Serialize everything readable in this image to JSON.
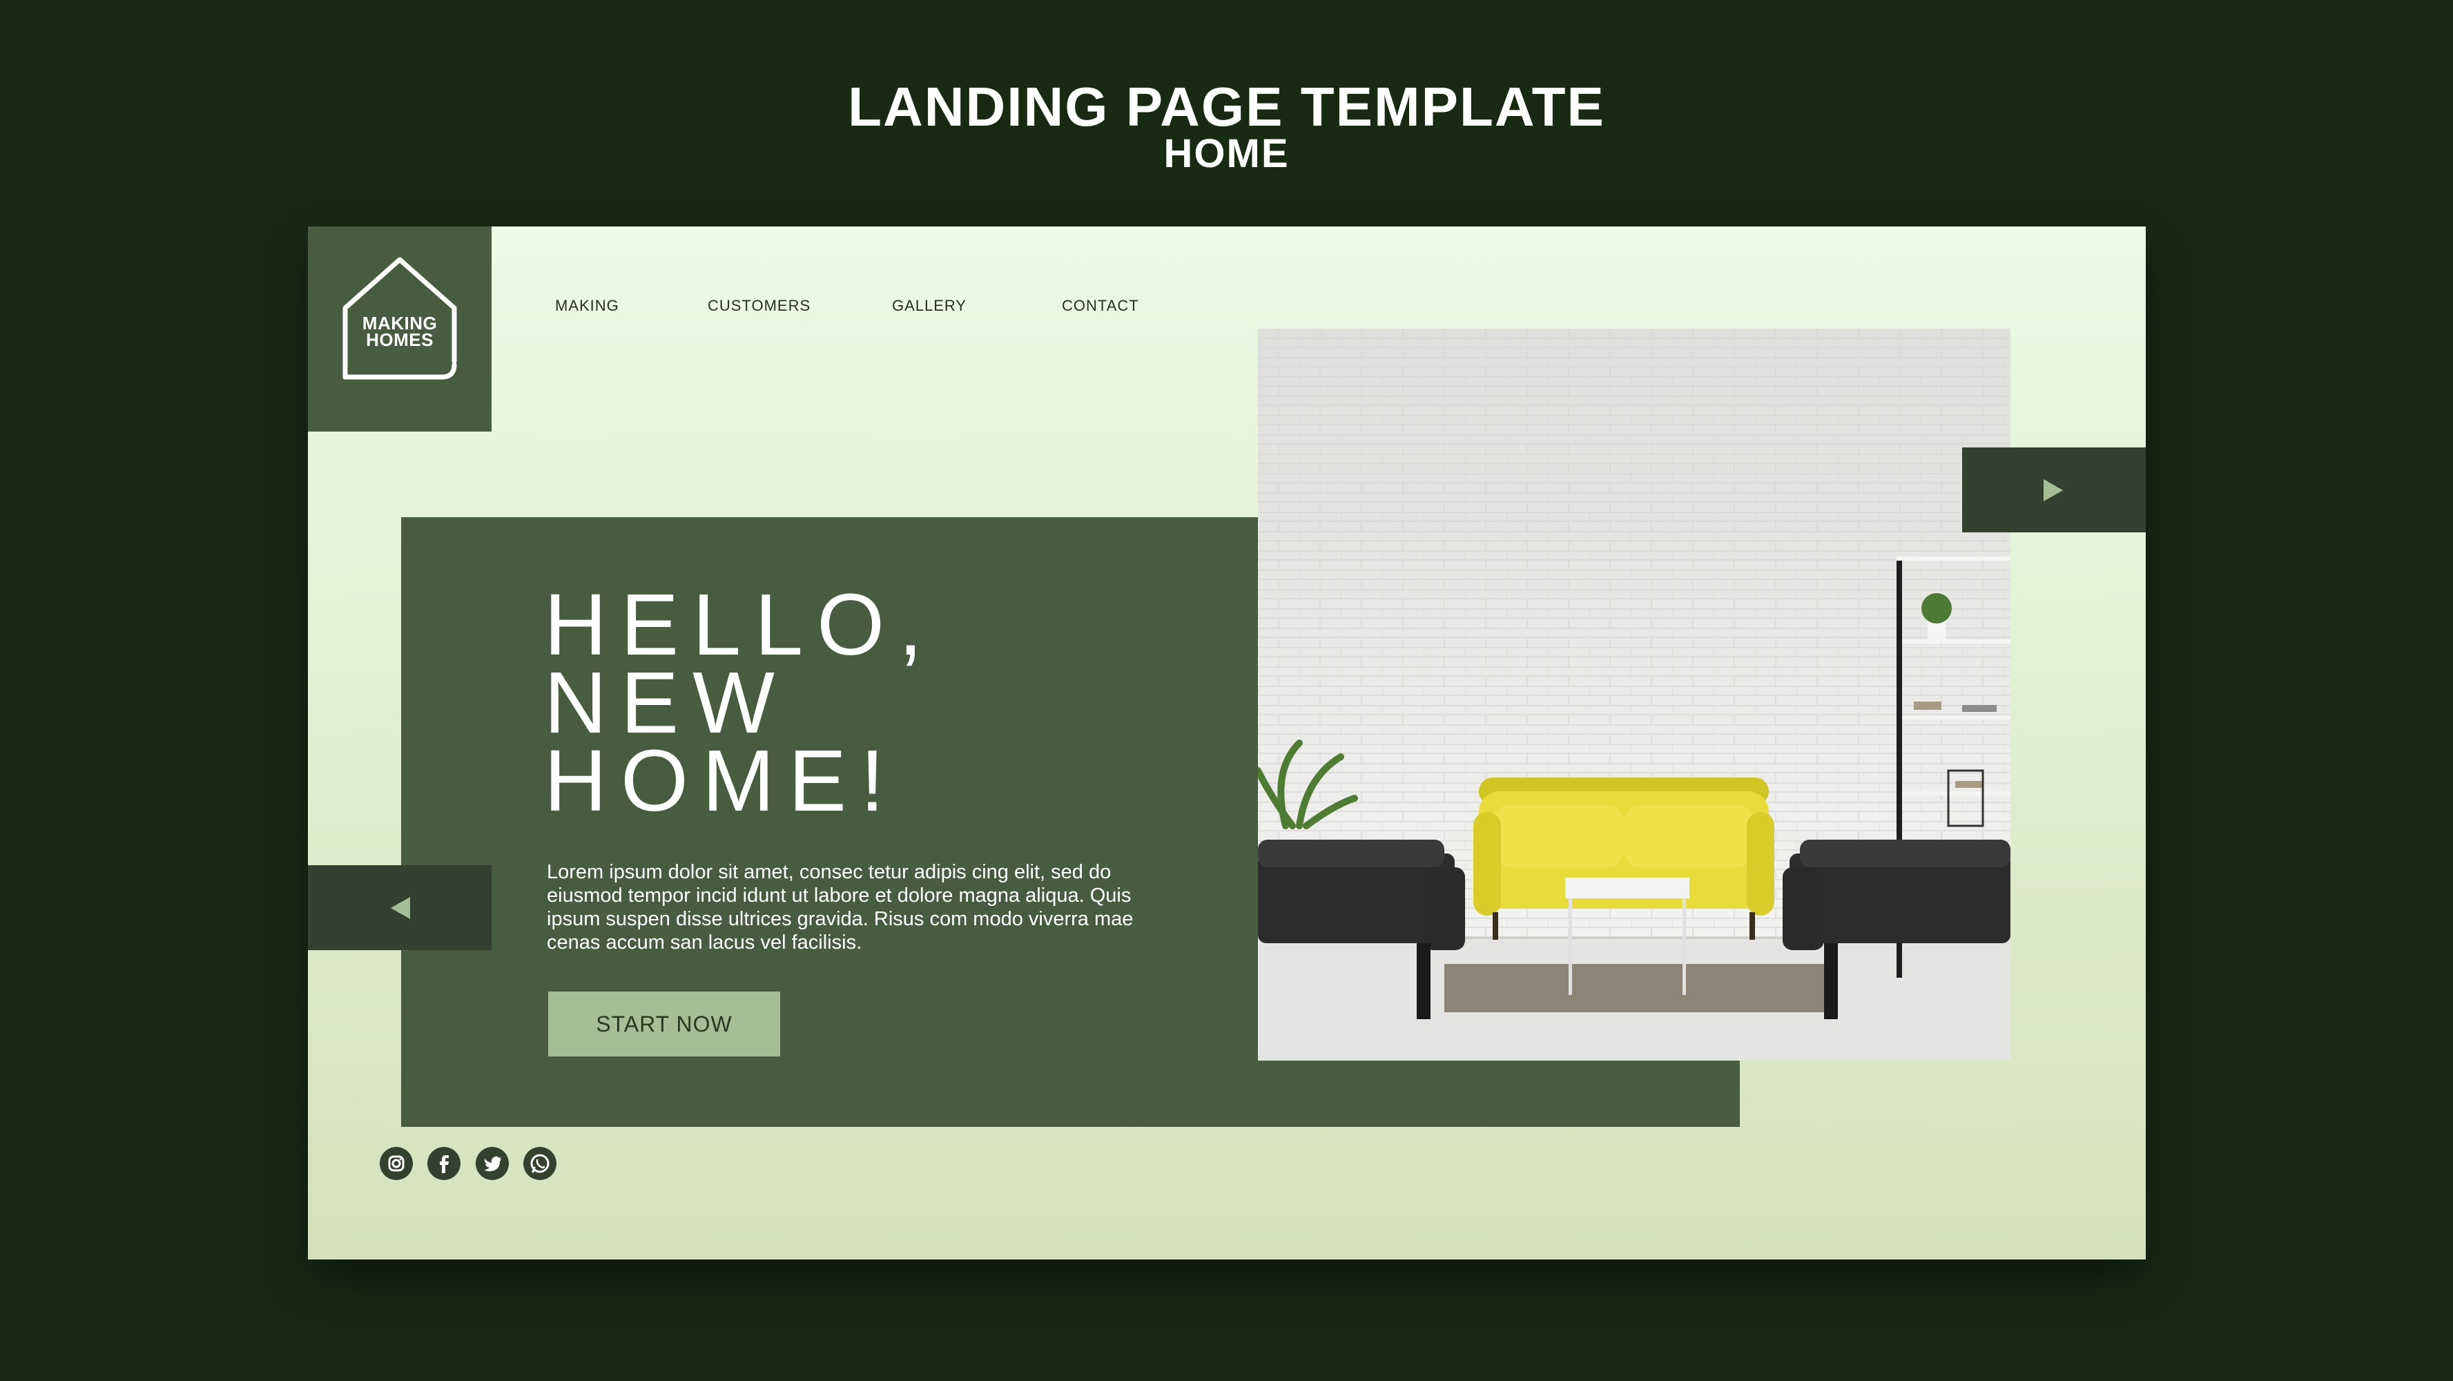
{
  "showcase": {
    "title": "LANDING PAGE TEMPLATE",
    "subtitle": "HOME"
  },
  "logo": {
    "line1": "MAKING",
    "line2": "HOMES",
    "icon": "house-outline-icon"
  },
  "nav": {
    "items": [
      {
        "label": "MAKING"
      },
      {
        "label": "CUSTOMERS"
      },
      {
        "label": "GALLERY"
      },
      {
        "label": "CONTACT"
      }
    ]
  },
  "hero": {
    "title_line1": "HELLO,",
    "title_line2": "NEW",
    "title_line3": "HOME!",
    "body": "Lorem ipsum dolor sit amet, consec tetur adipis cing elit, sed do eiusmod tempor incid idunt ut labore et dolore magna aliqua. Quis ipsum suspen disse ultrices gravida. Risus com modo viverra mae cenas accum san lacus vel facilisis.",
    "cta_label": "START NOW"
  },
  "photo": {
    "subject": "living-room-photo",
    "icon": "living-room-image"
  },
  "carousel": {
    "next_icon": "arrow-right-icon",
    "prev_icon": "arrow-left-icon"
  },
  "social": [
    {
      "icon": "instagram-icon"
    },
    {
      "icon": "facebook-icon"
    },
    {
      "icon": "twitter-icon"
    },
    {
      "icon": "whatsapp-icon"
    }
  ],
  "colors": {
    "background": "#182a12",
    "card_top": "#ebfbe4",
    "card_bottom": "#d6e1bc",
    "panel": "#485d40",
    "dark_accent": "#34412e",
    "button": "#a4bf96",
    "sofa_yellow": "#e8dc3a"
  }
}
